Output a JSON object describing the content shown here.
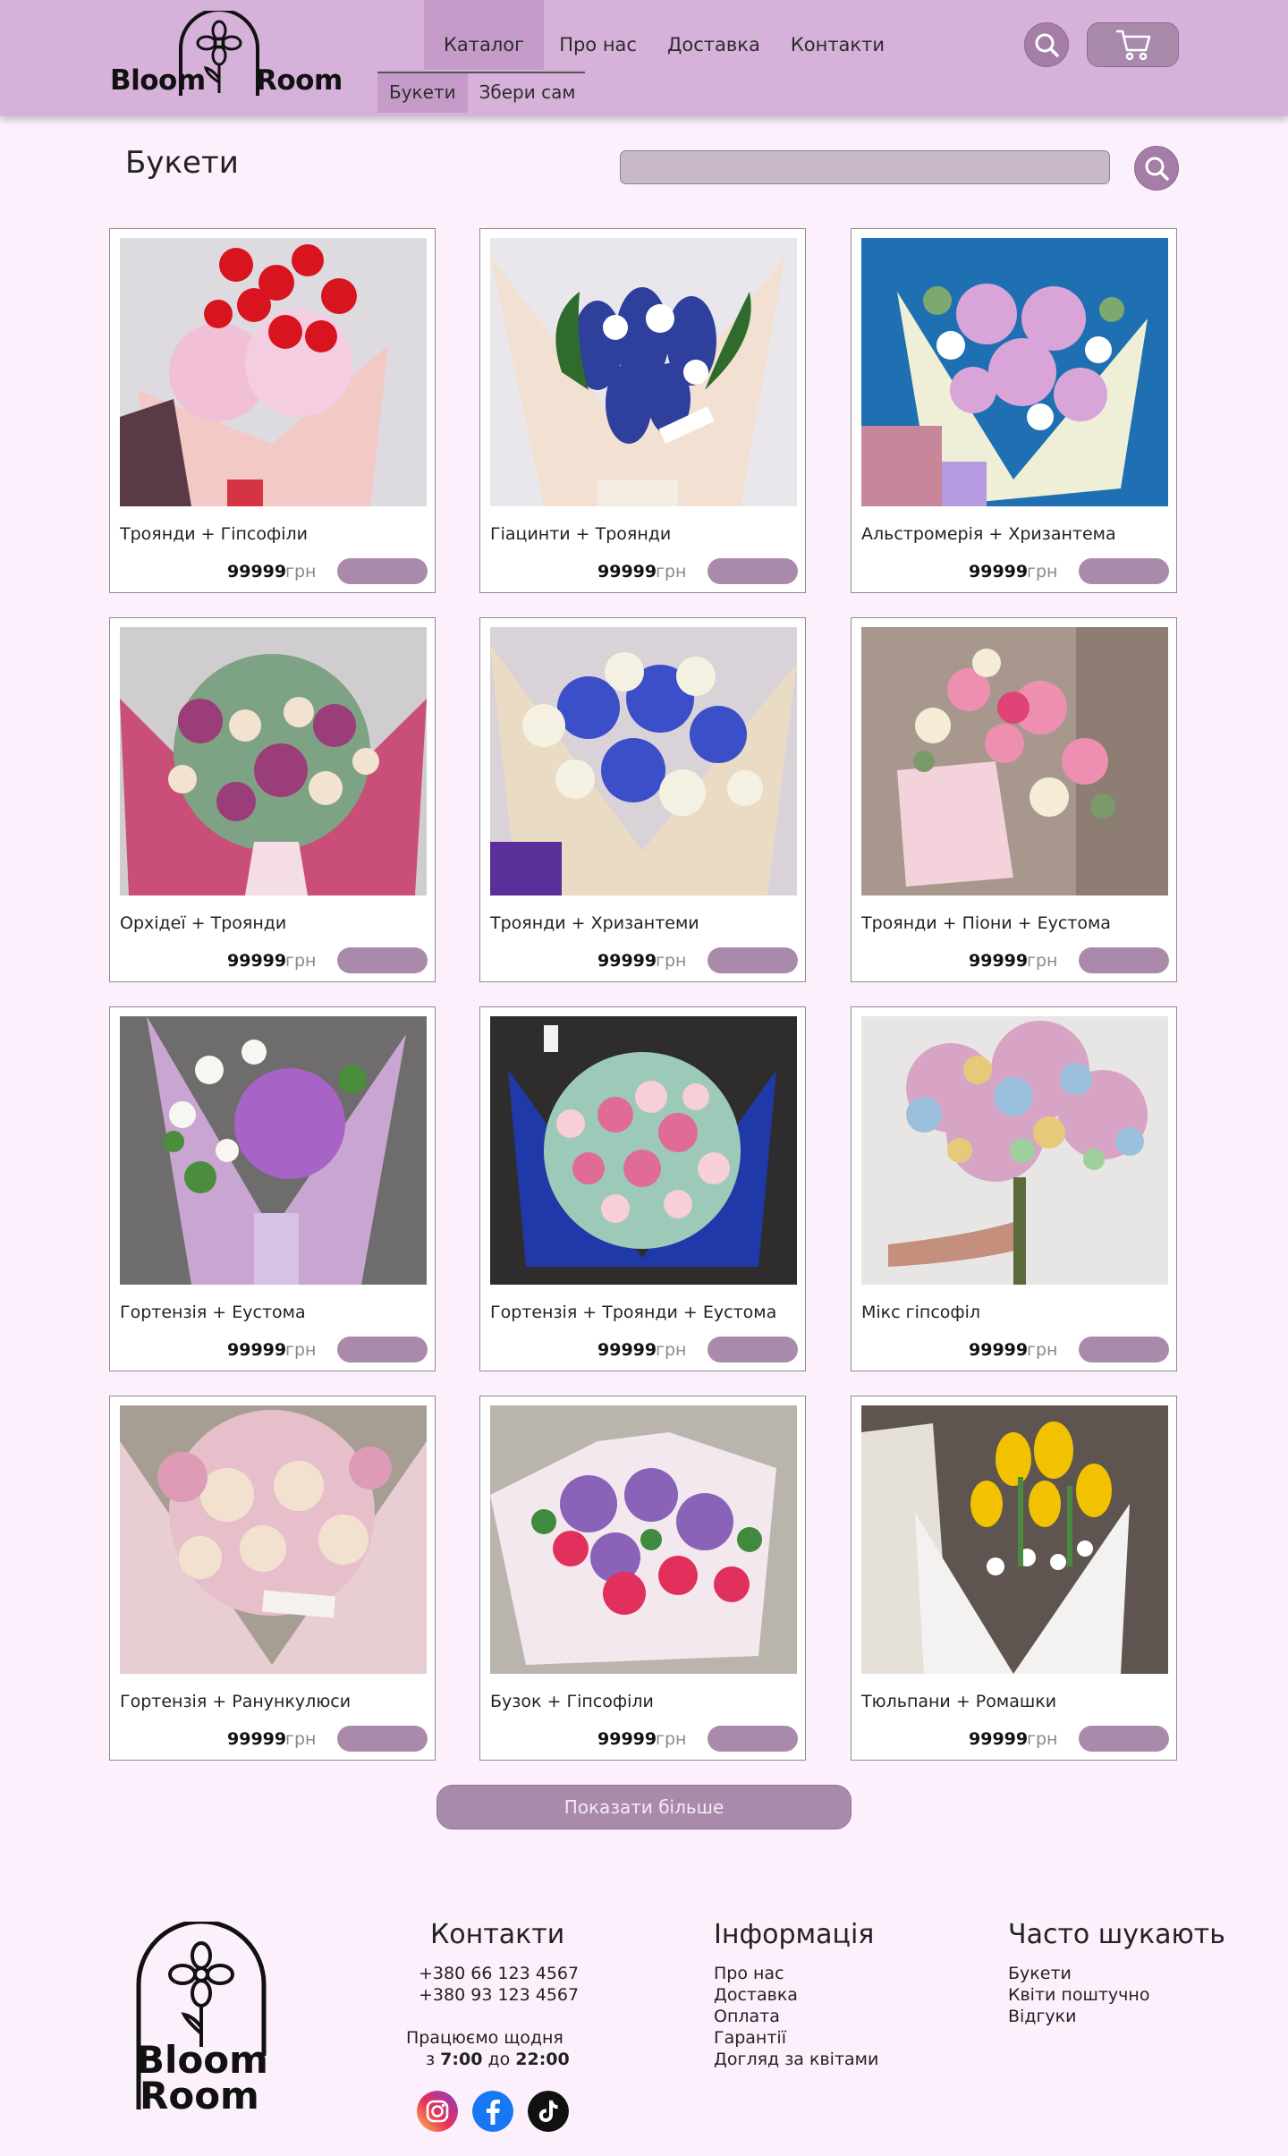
{
  "header": {
    "logo_left": "Bloom",
    "logo_right": "Room",
    "nav": [
      {
        "label": "Каталог",
        "active": true
      },
      {
        "label": "Про нас",
        "active": false
      },
      {
        "label": "Доставка",
        "active": false
      },
      {
        "label": "Контакти",
        "active": false
      }
    ],
    "subnav": [
      {
        "label": "Букети",
        "active": true
      },
      {
        "label": "Збери сам",
        "active": false
      }
    ],
    "search_icon": "search-icon",
    "cart_icon": "cart-icon"
  },
  "page": {
    "title": "Букети",
    "search_placeholder": "",
    "search_icon": "search-icon"
  },
  "products": [
    {
      "name": "Троянди + Гіпсофіли",
      "price": "99999",
      "currency": "грн"
    },
    {
      "name": "Гіацинти + Троянди",
      "price": "99999",
      "currency": "грн"
    },
    {
      "name": "Альстромерія + Хризантема",
      "price": "99999",
      "currency": "грн"
    },
    {
      "name": "Орхідеї + Троянди",
      "price": "99999",
      "currency": "грн"
    },
    {
      "name": "Троянди + Хризантеми",
      "price": "99999",
      "currency": "грн"
    },
    {
      "name": "Троянди + Піони + Еустома",
      "price": "99999",
      "currency": "грн"
    },
    {
      "name": "Гортензія + Еустома",
      "price": "99999",
      "currency": "грн"
    },
    {
      "name": "Гортензія + Троянди + Еустома",
      "price": "99999",
      "currency": "грн"
    },
    {
      "name": "Мікс гіпсофіл",
      "price": "99999",
      "currency": "грн"
    },
    {
      "name": "Гортензія + Ранункулюси",
      "price": "99999",
      "currency": "грн"
    },
    {
      "name": "Бузок + Гіпсофіли",
      "price": "99999",
      "currency": "грн"
    },
    {
      "name": "Тюльпани + Ромашки",
      "price": "99999",
      "currency": "грн"
    }
  ],
  "show_more": "Показати більше",
  "footer": {
    "logo_top": "Bloom",
    "logo_bottom": "Room",
    "contacts": {
      "title": "Контакти",
      "phones": [
        "+380 66 123 4567",
        "+380 93 123 4567"
      ],
      "hours_line1": "Працюємо щодня",
      "hours_prefix": "з ",
      "hours_from": "7:00",
      "hours_mid": " до ",
      "hours_to": "22:00"
    },
    "info": {
      "title": "Інформація",
      "links": [
        "Про нас",
        "Доставка",
        "Оплата",
        "Гарантії",
        "Догляд за квітами"
      ]
    },
    "popular": {
      "title": "Часто шукають",
      "links": [
        "Букети",
        "Квіти поштучно",
        "Відгуки"
      ]
    },
    "social": [
      "instagram-icon",
      "facebook-icon",
      "tiktok-icon"
    ]
  },
  "colors": {
    "background": "#fdf0fd",
    "header": "#d6b1d9",
    "accent": "#a98aab",
    "active_tab": "#c59cc9"
  }
}
